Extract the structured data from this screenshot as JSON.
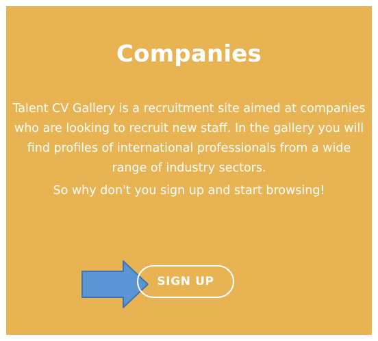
{
  "panel": {
    "background": "#e8b453",
    "title": "Companies",
    "paragraphs": [
      "Talent CV Gallery is a recruitment site aimed at companies who are looking to recruit new staff. In the gallery you will find profiles of international professionals from a wide range of industry sectors.",
      "So why don't you sign up and start browsing!"
    ],
    "signup_label": "SIGN UP"
  },
  "annotation": {
    "arrow_icon": "right-arrow-icon",
    "arrow_color": "#5b95d3"
  }
}
